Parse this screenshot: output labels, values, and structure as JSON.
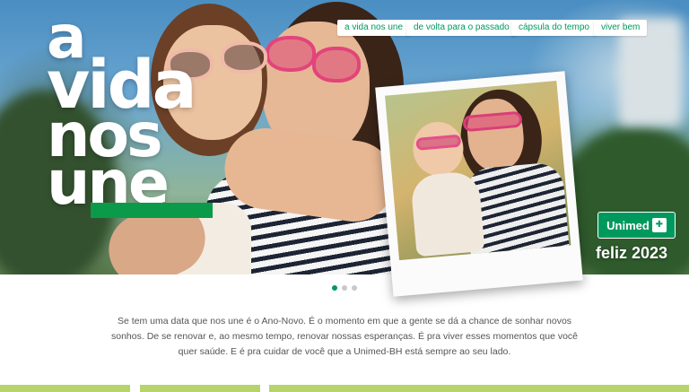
{
  "nav": {
    "items": [
      "a vida nos une",
      "de volta para o passado",
      "cápsula do tempo",
      "viver bem"
    ]
  },
  "hero": {
    "headline": [
      "a",
      "vida",
      "nos",
      "une"
    ]
  },
  "brand": {
    "logo_text": "Unimed",
    "logo_mark": "✚",
    "tagline": "feliz 2023",
    "accent_color": "#00995d"
  },
  "carousel": {
    "current": 1,
    "total": 3
  },
  "body": {
    "text": "Se tem uma data que nos une é o Ano-Novo. É o momento em que a gente se dá a chance de sonhar novos sonhos. De se renovar e, ao mesmo tempo, renovar nossas esperanças. É pra viver esses momentos que você quer saúde. E é pra cuidar de você que a Unimed-BH está sempre ao seu lado."
  }
}
